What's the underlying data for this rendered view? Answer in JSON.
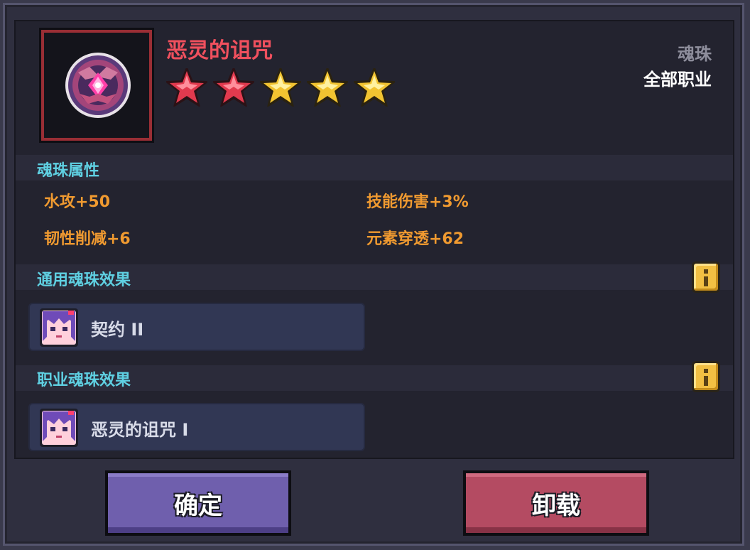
{
  "item": {
    "name": "恶灵的诅咒",
    "type": "魂珠",
    "class_restriction": "全部职业",
    "stars": [
      {
        "color": "red"
      },
      {
        "color": "red"
      },
      {
        "color": "gold"
      },
      {
        "color": "gold"
      },
      {
        "color": "gold"
      }
    ],
    "icon": "soul-orb-icon"
  },
  "attributes": {
    "title": "魂珠属性",
    "list": [
      "水攻+50",
      "技能伤害+3%",
      "韧性削减+6",
      "元素穿透+62"
    ]
  },
  "general_effect": {
    "title": "通用魂珠效果",
    "effect_label": "契约 II",
    "icon": "character-portrait-icon"
  },
  "class_effect": {
    "title": "职业魂珠效果",
    "effect_label": "恶灵的诅咒 I",
    "icon": "character-portrait-icon"
  },
  "buttons": {
    "confirm": "确定",
    "unload": "卸载"
  },
  "colors": {
    "item_name": "#f0505e",
    "section_title": "#5fd0e2",
    "attribute": "#f09a30",
    "confirm_button": "#6f5fad",
    "unload_button": "#b44b62"
  }
}
